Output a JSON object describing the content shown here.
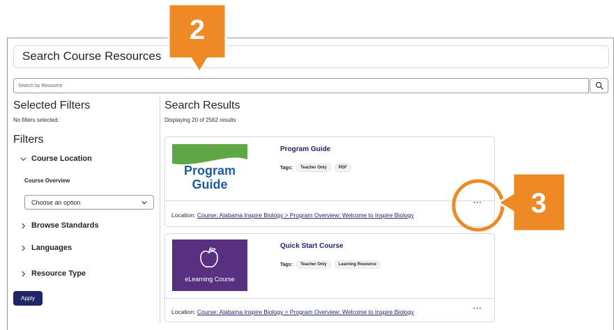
{
  "page": {
    "title": "Search Course Resources",
    "search_placeholder": "Search by Resource",
    "search_icon": "search-icon"
  },
  "sidebar": {
    "selected_filters_heading": "Selected Filters",
    "no_filters_text": "No filters selected.",
    "filters_heading": "Filters",
    "course_location": {
      "label": "Course Location",
      "expanded": true,
      "sub_label": "Course Overview",
      "select_value": "Choose an option"
    },
    "collapsed_sections": [
      "Browse Standards",
      "Languages",
      "Resource Type"
    ],
    "apply_label": "Apply"
  },
  "results": {
    "heading": "Search Results",
    "count_text": "Displaying 20 of 2562 results",
    "items": [
      {
        "title": "Program Guide",
        "thumbnail_text": [
          "Program",
          "Guide"
        ],
        "tags_label": "Tags:",
        "tags": [
          "Teacher Only",
          "PDF"
        ],
        "location_label": "Location:",
        "location_link": "Course: Alabama Inspire Biology > Program Overview: Welcome to Inspire Biology",
        "more_label": "···"
      },
      {
        "title": "Quick Start Course",
        "thumbnail_text": [
          "eLearning Course"
        ],
        "tags_label": "Tags:",
        "tags": [
          "Teacher Only",
          "Learning Resource"
        ],
        "location_label": "Location:",
        "location_link": "Course: Alabama Inspire Biology > Program Overview: Welcome to Inspire Biology",
        "more_label": "···"
      }
    ]
  },
  "callouts": [
    "2",
    "3"
  ],
  "colors": {
    "accent_orange": "#ee8a25",
    "navy": "#1f2666",
    "guide_green": "#5fa644",
    "guide_blue": "#1e5c9e",
    "elearning_purple": "#57307f"
  }
}
